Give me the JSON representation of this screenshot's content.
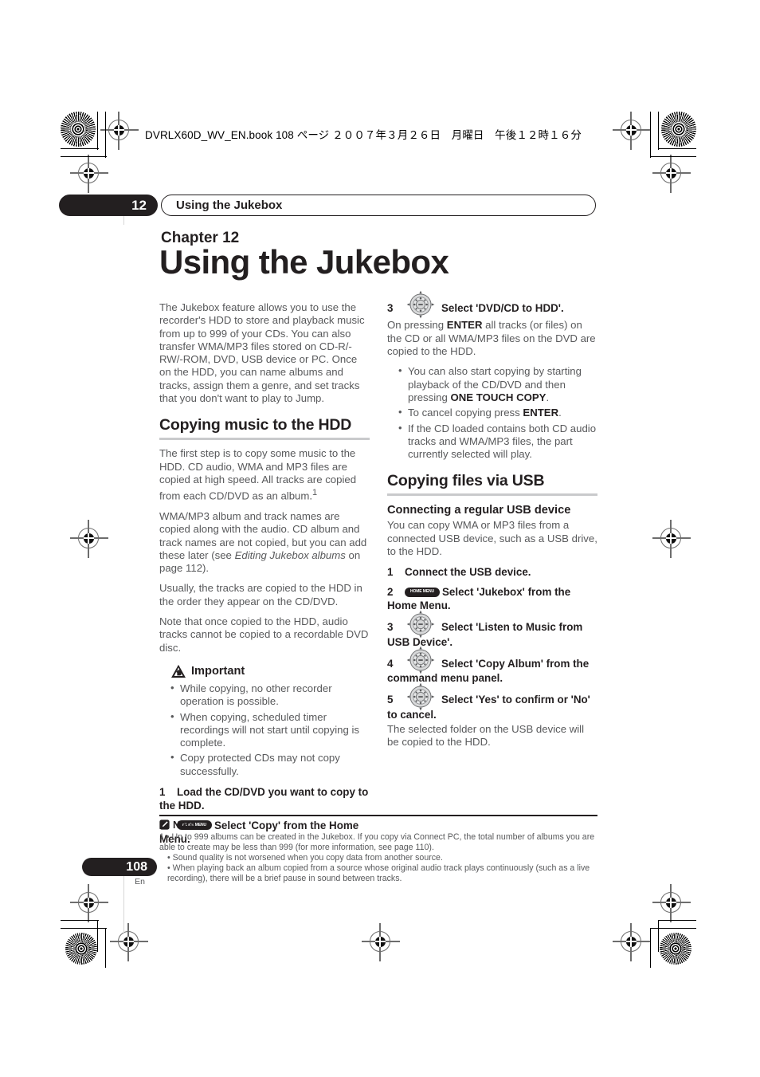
{
  "header": {
    "file_line": "DVRLX60D_WV_EN.book  108 ページ ２００７年３月２６日　月曜日　午後１２時１６分"
  },
  "running": {
    "chapter_number": "12",
    "title": "Using the Jukebox"
  },
  "title_block": {
    "chapter_label": "Chapter 12",
    "chapter_title": "Using the Jukebox"
  },
  "left_column": {
    "intro": "The Jukebox feature allows you to use the recorder's HDD to store and playback music from up to 999 of your CDs. You can also transfer WMA/MP3 files stored on CD-R/-RW/-ROM, DVD, USB device or PC. Once on the HDD, you can name albums and tracks, assign them a genre, and set tracks that you don't want to play to Jump.",
    "section_heading": "Copying music to the HDD",
    "para1_a": "The first step is to copy some music to the HDD. CD audio, WMA and MP3 files are copied at high speed. All tracks are copied from each CD/DVD as an album.",
    "para1_footnote_marker": "1",
    "para2_a": "WMA/MP3 album and track names are copied along with the audio. CD album and track names are not copied, but you can add these later (see ",
    "para2_italic": "Editing Jukebox albums",
    "para2_b": " on page 112).",
    "para3": "Usually, the tracks are copied to the HDD in the order they appear on the CD/DVD.",
    "para4": "Note that once copied to the HDD, audio tracks cannot be copied to a recordable DVD disc.",
    "important_label": "Important",
    "important_bullets": [
      "While copying, no other recorder operation is possible.",
      "When copying, scheduled timer recordings will not start until copying is complete.",
      "Copy protected CDs may not copy successfully."
    ],
    "step1_num": "1",
    "step1_text": "Load the CD/DVD you want to copy to the HDD.",
    "step2_num": "2",
    "step2_icon": "home-menu-button",
    "step2_icon_label": "HOME MENU",
    "step2_text": "Select 'Copy' from the Home Menu."
  },
  "right_column": {
    "step3_num": "3",
    "step3_icon": "cursor-pad-enter",
    "step3_text": "Select 'DVD/CD to HDD'.",
    "step3_body_a": "On pressing ",
    "step3_body_bold": "ENTER",
    "step3_body_b": " all tracks (or files) on the CD or all WMA/MP3 files on the DVD are copied to the HDD.",
    "step3_bullet1_a": "You can also start copying by starting playback of the CD/DVD and then pressing ",
    "step3_bullet1_bold": "ONE TOUCH COPY",
    "step3_bullet1_b": ".",
    "step3_bullet2_a": "To cancel copying press ",
    "step3_bullet2_bold": "ENTER",
    "step3_bullet2_b": ".",
    "step3_bullet3": "If the CD loaded contains both CD audio tracks and WMA/MP3 files, the part currently selected will play.",
    "section_heading": "Copying files via USB",
    "subsection_heading": "Connecting a regular USB device",
    "usb_intro": "You can copy WMA or MP3 files from a connected USB device, such as a USB drive, to the HDD.",
    "step1_num": "1",
    "step1_text": "Connect the USB device.",
    "step2_num": "2",
    "step2_icon": "home-menu-button",
    "step2_icon_label": "HOME MENU",
    "step2_text": "Select 'Jukebox' from the Home Menu.",
    "step3b_num": "3",
    "step3b_icon": "cursor-pad-enter",
    "step3b_text": "Select 'Listen to Music from USB Device'.",
    "step4_num": "4",
    "step4_icon": "cursor-pad-enter",
    "step4_text": "Select 'Copy Album' from the command menu panel.",
    "step5_num": "5",
    "step5_icon": "cursor-pad-enter",
    "step5_text": "Select 'Yes' to confirm or 'No' to cancel.",
    "step5_body": "The selected folder on the USB device will be copied to the HDD."
  },
  "notes": {
    "label": "Note",
    "icon": "pencil-note-icon",
    "item1_marker": "1",
    "item1_text": "Up to 999 albums can be created in the Jukebox. If  you copy via Connect PC, the total number of albums you are able to create may be less than 999 (for more information, see page 110).",
    "item2_text": "Sound quality is not worsened when you copy data from another source.",
    "item3_text": "When playing back an album copied from a source whose original audio track plays continuously (such as a live recording), there will be a brief pause in sound between tracks."
  },
  "footer": {
    "page_number": "108",
    "language": "En"
  },
  "colors": {
    "ink": "#231f20",
    "body_text": "#58595b",
    "rule": "#c9cacc"
  }
}
